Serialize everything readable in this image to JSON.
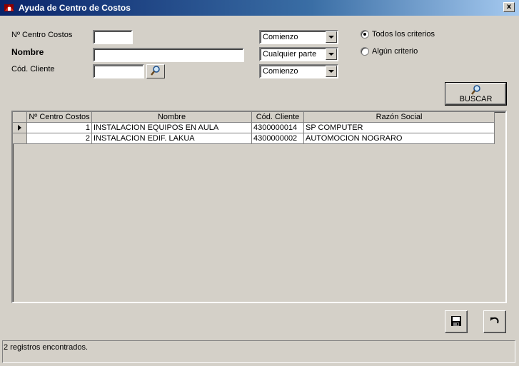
{
  "window": {
    "title": "Ayuda de Centro de Costos",
    "close_label": "x"
  },
  "form": {
    "nro_centro_label": "Nº Centro Costos",
    "nro_centro_value": "",
    "nombre_label": "Nombre",
    "nombre_value": "",
    "cod_cliente_label": "Cód. Cliente",
    "cod_cliente_value": "",
    "combo_1": "Comienzo",
    "combo_2": "Cualquier parte",
    "combo_3": "Comienzo"
  },
  "criteria": {
    "todos_label": "Todos los criterios",
    "algun_label": "Algún criterio",
    "selected": "todos"
  },
  "buscar_label": "BUSCAR",
  "table": {
    "columns": [
      "Nº Centro Costos",
      "Nombre",
      "Cód. Cliente",
      "Razón Social"
    ],
    "rows": [
      {
        "nro": "1",
        "nombre": "INSTALACION EQUIPOS EN AULA",
        "cod_cliente": "4300000014",
        "razon_social": "SP COMPUTER"
      },
      {
        "nro": "2",
        "nombre": "INSTALACION EDIF. LAKUA",
        "cod_cliente": "4300000002",
        "razon_social": "AUTOMOCION NOGRARO"
      }
    ]
  },
  "status": "2 registros encontrados.",
  "icons": {
    "app": "app-icon",
    "lookup": "search-icon",
    "buscar": "search-icon",
    "save": "save-icon",
    "undo": "undo-icon"
  }
}
